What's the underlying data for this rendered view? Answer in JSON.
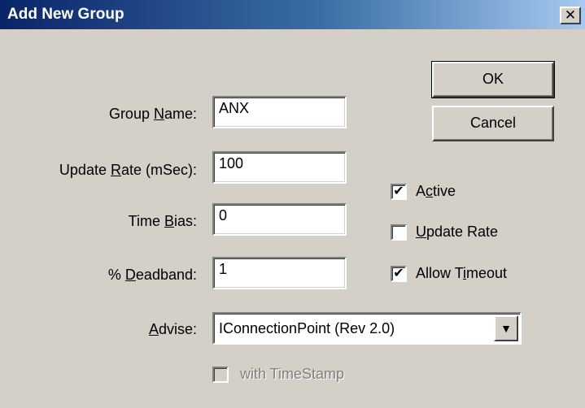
{
  "window": {
    "title": "Add New Group",
    "close_glyph": "✕"
  },
  "form": {
    "group_name": {
      "label_pre": "Group ",
      "label_accel": "N",
      "label_post": "ame:",
      "value": "ANX"
    },
    "update_rate": {
      "label_pre": "Update ",
      "label_accel": "R",
      "label_post": "ate (mSec):",
      "value": "100"
    },
    "time_bias": {
      "label_pre": "Time ",
      "label_accel": "B",
      "label_post": "ias:",
      "value": "0"
    },
    "deadband": {
      "label_pre": "% ",
      "label_accel": "D",
      "label_post": "eadband:",
      "value": "1"
    },
    "advise": {
      "label_pre": "",
      "label_accel": "A",
      "label_post": "dvise:",
      "value": "IConnectionPoint (Rev 2.0)"
    }
  },
  "buttons": {
    "ok": "OK",
    "cancel": "Cancel"
  },
  "checkboxes": {
    "active": {
      "label_pre": "A",
      "label_accel": "c",
      "label_post": "tive",
      "checked": true
    },
    "update_rate": {
      "label_pre": "",
      "label_accel": "U",
      "label_post": "pdate Rate",
      "checked": false
    },
    "allow_timeout": {
      "label_pre": "Allow T",
      "label_accel": "i",
      "label_post": "meout",
      "checked": true
    },
    "with_timestamp": {
      "label": "with TimeStamp",
      "checked": false,
      "enabled": false
    }
  },
  "icons": {
    "check": "check-mark",
    "dropdown": "chevron-down"
  }
}
